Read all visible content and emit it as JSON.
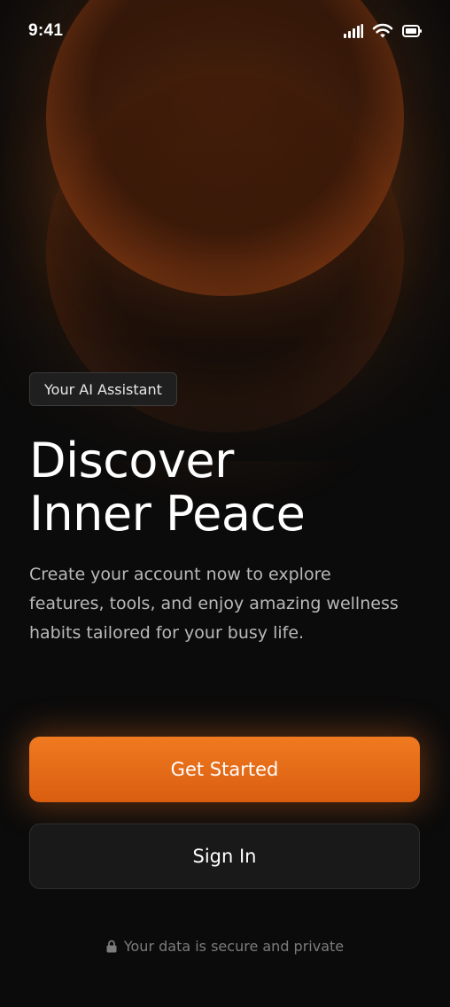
{
  "status_bar": {
    "time": "9:41",
    "icons": [
      "cellular-signal-icon",
      "wifi-icon",
      "battery-icon"
    ]
  },
  "hero": {
    "decoration": "glowing-orange-circles",
    "accent_color": "#e86e1e"
  },
  "badge": {
    "label": "Your AI Assistant"
  },
  "headline": {
    "line1": "Discover",
    "line2": "Inner Peace"
  },
  "description": "Create your account now to explore features, tools, and enjoy amazing wellness habits tailored for your busy life.",
  "actions": {
    "primary_label": "Get Started",
    "secondary_label": "Sign In"
  },
  "footer": {
    "icon": "lock-icon",
    "note": "Your data is secure and private"
  },
  "colors": {
    "background": "#0b0b0b",
    "primary": "#e86e1e",
    "text": "#ffffff",
    "muted": "#b9b9b9"
  }
}
